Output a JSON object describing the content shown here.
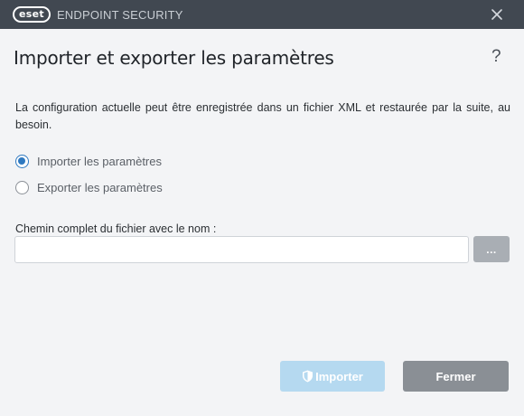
{
  "window": {
    "logo_text": "eset",
    "product_name": "ENDPOINT SECURITY"
  },
  "dialog": {
    "title": "Importer et exporter les paramètres",
    "help_label": "?",
    "description": "La configuration actuelle peut être enregistrée dans un fichier XML et restaurée par la suite, au besoin.",
    "options": [
      {
        "label": "Importer les paramètres",
        "selected": true
      },
      {
        "label": "Exporter les paramètres",
        "selected": false
      }
    ],
    "path_field": {
      "label": "Chemin complet du fichier avec le nom :",
      "value": "",
      "browse_label": "..."
    },
    "buttons": {
      "import_label": "Importer",
      "close_label": "Fermer"
    }
  },
  "colors": {
    "titlebar": "#414851",
    "accent": "#2f79c0",
    "import_button": "#b5d9f0",
    "close_button": "#8a8f95"
  },
  "icons": {
    "close": "close-icon",
    "import": "shield-icon"
  }
}
